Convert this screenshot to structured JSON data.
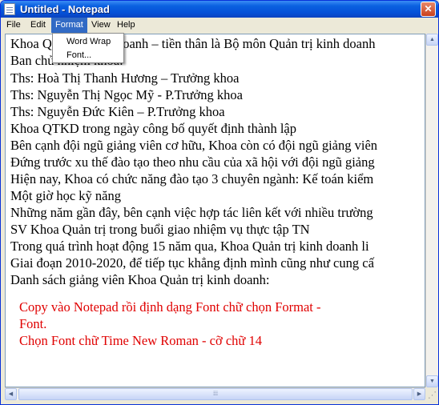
{
  "window": {
    "title": "Untitled - Notepad"
  },
  "menu": {
    "file": "File",
    "edit": "Edit",
    "format": "Format",
    "view": "View",
    "help": "Help"
  },
  "format_menu": {
    "word_wrap": "Word Wrap",
    "font": "Font..."
  },
  "document": {
    "lines": [
      "Khoa Quản trị kinh doanh – tiền thân là Bộ môn Quản trị kinh doanh",
      "Ban chủ nhiệm khoa:",
      " Ths:  Hoà Thị Thanh Hương – Trưởng khoa",
      " Ths:  Nguyễn Thị Ngọc Mỹ - P.Trưởng khoa",
      " Ths: Nguyễn Đức Kiên – P.Trưởng khoa",
      "Khoa QTKD trong ngày công bố quyết định thành lập",
      "Bên cạnh đội ngũ giảng viên cơ hữu, Khoa còn có đội ngũ giảng viên",
      "Đứng trước xu thế đào tạo theo nhu cầu của xã hội với đội ngũ giảng",
      "Hiện nay, Khoa có chức năng đào tạo 3 chuyên ngành: Kế toán kiểm",
      "Một giờ học kỹ năng",
      "Những năm gần đây, bên cạnh việc hợp tác liên kết với nhiều trường",
      "SV Khoa Quản trị trong buổi giao nhiệm vụ thực tập TN",
      "Trong quá trình hoạt động 15 năm qua, Khoa Quản trị kinh doanh  li",
      "Giai đoạn 2010-2020, để tiếp tục khẳng định mình cũng như cung cấ",
      "Danh sách giảng viên Khoa Quản trị kinh doanh:"
    ],
    "note": [
      "Copy vào Notepad rồi định dạng Font chữ chọn Format -",
      "Font.",
      "Chọn Font chữ Time New Roman - cỡ chữ 14"
    ]
  },
  "colors": {
    "title_bar": "#0551d8",
    "menu_highlight": "#316ac5",
    "note_text": "#e00000"
  }
}
